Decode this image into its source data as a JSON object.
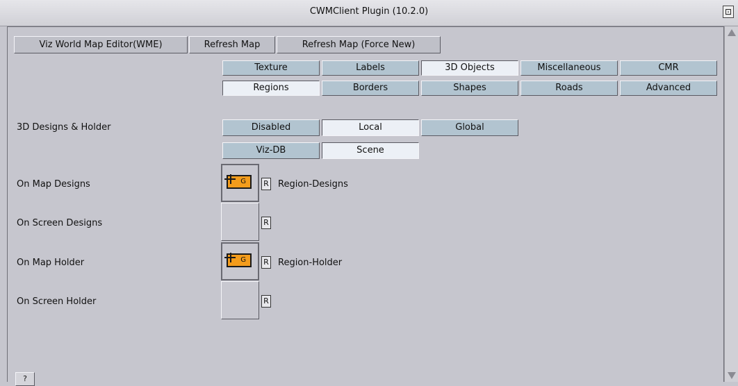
{
  "window": {
    "title": "CWMClient Plugin (10.2.0)"
  },
  "toolbar": {
    "wme_label": "Viz World Map Editor(WME)",
    "refresh_label": "Refresh Map",
    "refresh_force_label": "Refresh Map (Force New)"
  },
  "tabs": {
    "row1": [
      "Texture",
      "Labels",
      "3D Objects",
      "Miscellaneous",
      "CMR"
    ],
    "row2": [
      "Regions",
      "Borders",
      "Shapes",
      "Roads",
      "Advanced"
    ],
    "selected": [
      "3D Objects",
      "Regions"
    ]
  },
  "designs_holder": {
    "label": "3D Designs & Holder",
    "options": [
      "Disabled",
      "Local",
      "Global"
    ],
    "selected": "Local",
    "sources": [
      "Viz-DB",
      "Scene"
    ],
    "selected_source": "Scene"
  },
  "slots": [
    {
      "label": "On Map Designs",
      "value": "Region-Designs",
      "icon": "container-icon"
    },
    {
      "label": "On Screen Designs",
      "value": ""
    },
    {
      "label": "On Map Holder",
      "value": "Region-Holder",
      "icon": "container-icon"
    },
    {
      "label": "On Screen Holder",
      "value": ""
    }
  ],
  "slot_reset_label": "R",
  "container_icon_glyph": "G",
  "pin_glyph": "⊡",
  "help_label": "?",
  "colors": {
    "tab": "#b2c4d0",
    "selected": "#ecf0f6",
    "container": "#f39c1c"
  }
}
